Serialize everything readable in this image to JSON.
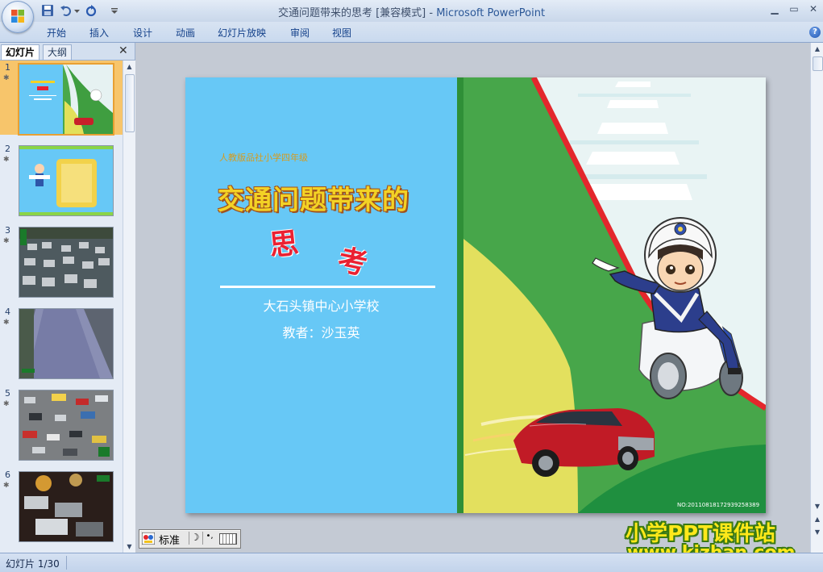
{
  "window": {
    "title": "交通问题带来的思考 [兼容模式]",
    "title_separator": " - ",
    "app_name": "Microsoft PowerPoint",
    "minimize": "▁",
    "restore": "▭",
    "close": "✕"
  },
  "ribbon": {
    "tabs": [
      "开始",
      "插入",
      "设计",
      "动画",
      "幻灯片放映",
      "审阅",
      "视图"
    ],
    "help": "?"
  },
  "left_pane": {
    "tab_slides": "幻灯片",
    "tab_outline": "大纲",
    "close": "✕",
    "thumbnails": [
      {
        "number": "1",
        "star": "✱",
        "selected": true
      },
      {
        "number": "2",
        "star": "✱",
        "selected": false
      },
      {
        "number": "3",
        "star": "✱",
        "selected": false
      },
      {
        "number": "4",
        "star": "✱",
        "selected": false
      },
      {
        "number": "5",
        "star": "✱",
        "selected": false
      },
      {
        "number": "6",
        "star": "✱",
        "selected": false
      }
    ]
  },
  "slide": {
    "subtitle": "人教版品社小学四年级",
    "title_line1": "交通问题带来的",
    "title_char1": "思",
    "title_char2": "考",
    "school": "大石头镇中心小学校",
    "teacher": "教者：沙玉英",
    "image_code": "NO:20110818172939258389"
  },
  "ime": {
    "mode": "标准",
    "moon": "☽",
    "punct": "•,"
  },
  "watermark": {
    "line1": "小学PPT课件站",
    "line2": "www.kjzhan.com"
  },
  "status": {
    "slide_counter": "幻灯片 1/30"
  },
  "colors": {
    "slide_blue": "#67c8f6",
    "title_yellow": "#f3d225",
    "title_red": "#ea2132",
    "selection_orange": "#f7c56b"
  }
}
